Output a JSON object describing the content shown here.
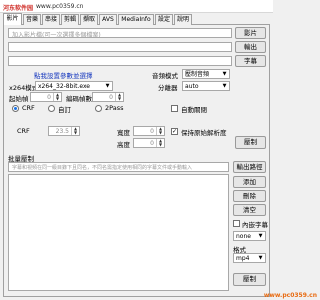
{
  "window": {
    "title_prefix": "河东软件园",
    "title_url": "www.pc0359.cn"
  },
  "tabs": [
    {
      "label": "影片"
    },
    {
      "label": "音樂"
    },
    {
      "label": "串接"
    },
    {
      "label": "剪輯"
    },
    {
      "label": "擷取"
    },
    {
      "label": "AVS"
    },
    {
      "label": "MediaInfo"
    },
    {
      "label": "設定"
    },
    {
      "label": "說明"
    }
  ],
  "main": {
    "file_placeholder": "加入影片檔(可一次選擇多個檔案)",
    "open_btn": "影片",
    "output_btn": "輸出",
    "subtitle_btn": "字幕",
    "preset_label": "點我設置參數並選擇",
    "encoder_label": "x264模式",
    "encoder_value": "x264_32-8bit.exe",
    "start_frame_label": "起始幀",
    "start_frame_value": "0",
    "encode_frames_label": "編碼幀數",
    "encode_frames_value": "0",
    "audio_mode_label": "音頻模式",
    "audio_mode_value": "壓制音頻",
    "splitter_label": "分離器",
    "splitter_value": "auto",
    "crf_label": "CRF",
    "custom_label": "自訂",
    "twopass_label": "2Pass",
    "auto_close_label": "自動關閉",
    "crf_field_label": "CRF",
    "crf_value": "23.5",
    "width_label": "寬度",
    "width_value": "0",
    "height_label": "高度",
    "height_value": "0",
    "keep_aspect_label": "保持原始解析度",
    "compress_btn": "壓制",
    "batch_title": "批量壓制",
    "batch_placeholder": "字幕和視頻在同一級目錄下且同名，不同名需指定使用相同的字幕文件或手動輸入",
    "batch_settings_btn": "輸出路徑",
    "add_btn": "添加",
    "remove_btn": "刪除",
    "clear_btn": "清空",
    "embed_sub_label": "內嵌字幕",
    "sub_mode_value": "none",
    "format_label": "格式",
    "format_value": "mp4",
    "start_btn": "壓制"
  },
  "watermark": "www.pc0359.cn"
}
